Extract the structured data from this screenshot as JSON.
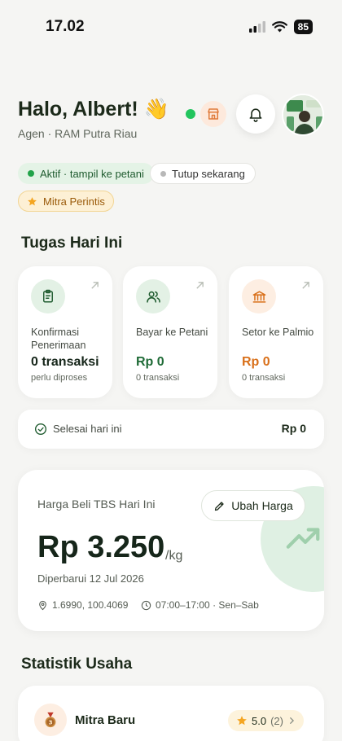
{
  "status_bar": {
    "time": "17.02",
    "battery": "85"
  },
  "header": {
    "greeting": "Halo, Albert! 👋",
    "subtitle": "Agen · RAM Putra Riau"
  },
  "status_chips": {
    "active": "Aktif · tampil ke petani",
    "close": "Tutup sekarang",
    "badge": "Mitra Perintis"
  },
  "tasks": {
    "title": "Tugas Hari Ini",
    "items": [
      {
        "label": "Konfirmasi Penerimaan",
        "value": "0 transaksi",
        "sub": "perlu diproses",
        "color": "#16261a"
      },
      {
        "label": "Bayar ke Petani",
        "value": "Rp 0",
        "sub": "0 transaksi",
        "color": "#1f6b37"
      },
      {
        "label": "Setor ke Palmio",
        "value": "Rp 0",
        "sub": "0 transaksi",
        "color": "#d9701a"
      }
    ],
    "done_label": "Selesai hari ini",
    "done_value": "Rp 0"
  },
  "price": {
    "title": "Harga Beli TBS Hari Ini",
    "edit_label": "Ubah Harga",
    "value": "Rp 3.250",
    "unit": "/kg",
    "updated": "Diperbarui 12 Jul 2026",
    "coords": "1.6990, 100.4069",
    "hours": "07:00–17:00 · Sen–Sab"
  },
  "stats": {
    "title": "Statistik Usaha",
    "level_label": "Mitra Baru",
    "rating": "5.0",
    "rating_count": "(2)"
  },
  "colors": {
    "primary": "#1f6b37",
    "accent_orange": "#d9701a",
    "online": "#22c55e",
    "background": "#f5f5f3"
  }
}
